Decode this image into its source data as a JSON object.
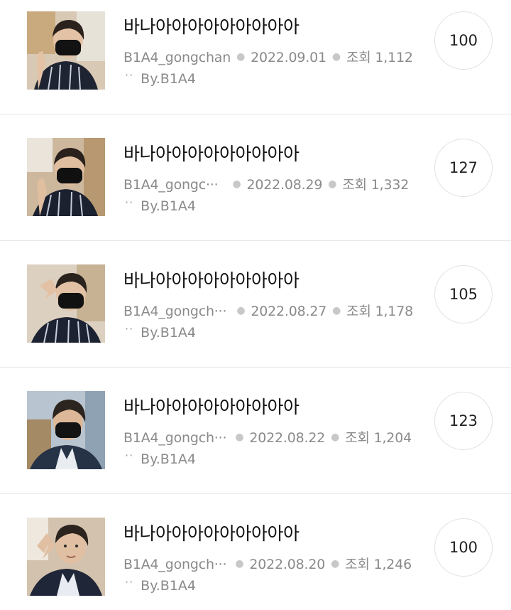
{
  "posts": [
    {
      "title": "바나아아아아아아아아아",
      "author": "B1A4_gongchan",
      "date": "2022.09.01",
      "views": "조회 1,112",
      "by": "By.B1A4",
      "count": "100",
      "thumb_bg": "#d8c9b4"
    },
    {
      "title": "바나아아아아아아아아아",
      "author": "B1A4_gongc···",
      "date": "2022.08.29",
      "views": "조회 1,332",
      "by": "By.B1A4",
      "count": "127",
      "thumb_bg": "#cdb89d"
    },
    {
      "title": "바나아아아아아아아아아",
      "author": "B1A4_gongch···",
      "date": "2022.08.27",
      "views": "조회 1,178",
      "by": "By.B1A4",
      "count": "105",
      "thumb_bg": "#dcd0c0"
    },
    {
      "title": "바나아아아아아아아아아",
      "author": "B1A4_gongch···",
      "date": "2022.08.22",
      "views": "조회 1,204",
      "by": "By.B1A4",
      "count": "123",
      "thumb_bg": "#b8c4cf"
    },
    {
      "title": "바나아아아아아아아아아",
      "author": "B1A4_gongch···",
      "date": "2022.08.20",
      "views": "조회 1,246",
      "by": "By.B1A4",
      "count": "100",
      "thumb_bg": "#d3c2ad"
    }
  ]
}
